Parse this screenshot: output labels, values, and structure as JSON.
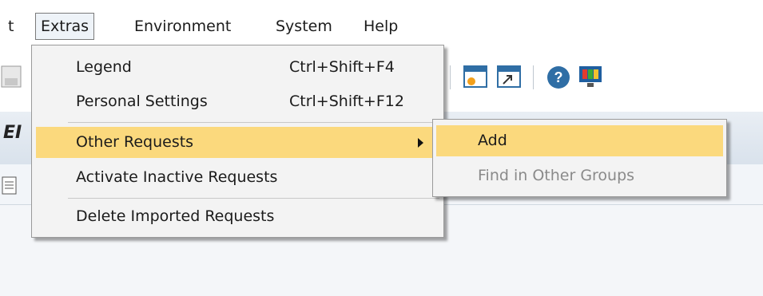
{
  "menubar": {
    "items": [
      {
        "label": "t"
      },
      {
        "label": "Extras"
      },
      {
        "label": "Environment"
      },
      {
        "label": "System"
      },
      {
        "label": "Help"
      }
    ]
  },
  "workspace": {
    "title_fragment": "EI"
  },
  "extras_menu": {
    "items": [
      {
        "label": "Legend",
        "accel": "Ctrl+Shift+F4"
      },
      {
        "label": "Personal Settings",
        "accel": "Ctrl+Shift+F12"
      },
      {
        "label": "Other Requests",
        "accel": ""
      },
      {
        "label": "Activate Inactive Requests",
        "accel": ""
      },
      {
        "label": "Delete Imported Requests",
        "accel": ""
      }
    ]
  },
  "other_requests_submenu": {
    "items": [
      {
        "label": "Add",
        "enabled": true
      },
      {
        "label": "Find in Other Groups",
        "enabled": false
      }
    ]
  },
  "colors": {
    "highlight": "#fbd97d",
    "menu_bg": "#f3f3f3",
    "disabled_text": "#8a8a8a"
  }
}
